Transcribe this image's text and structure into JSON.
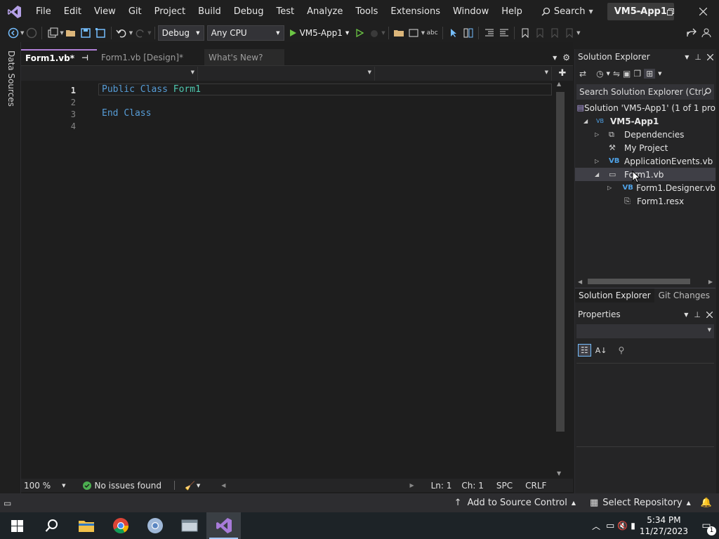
{
  "menu": [
    "File",
    "Edit",
    "View",
    "Git",
    "Project",
    "Build",
    "Debug",
    "Test",
    "Analyze",
    "Tools",
    "Extensions",
    "Window",
    "Help"
  ],
  "search_label": "Search",
  "project_badge": "VM5-App1",
  "toolbar": {
    "config": "Debug",
    "platform": "Any CPU",
    "run_label": "VM5-App1"
  },
  "left_strip": "Data Sources",
  "tabs": [
    {
      "label": "Form1.vb*",
      "active": true
    },
    {
      "label": "Form1.vb [Design]*",
      "active": false
    },
    {
      "label": "What's New?",
      "active": false
    }
  ],
  "code": {
    "line_numbers": [
      "1",
      "2",
      "3",
      "4"
    ],
    "line1": {
      "kw1": "Public",
      "kw2": "Class",
      "name": "Form1"
    },
    "line3": {
      "kw1": "End",
      "kw2": "Class"
    }
  },
  "editor_status": {
    "zoom": "100 %",
    "issues": "No issues found",
    "ln": "Ln: 1",
    "ch": "Ch: 1",
    "spc": "SPC",
    "crlf": "CRLF"
  },
  "solution_explorer": {
    "title": "Solution Explorer",
    "search_placeholder": "Search Solution Explorer (Ctrl",
    "items": [
      {
        "label": "Solution 'VM5-App1' (1 of 1 pro"
      },
      {
        "label": "VM5-App1"
      },
      {
        "label": "Dependencies"
      },
      {
        "label": "My Project"
      },
      {
        "label": "ApplicationEvents.vb"
      },
      {
        "label": "Form1.vb"
      },
      {
        "label": "Form1.Designer.vb"
      },
      {
        "label": "Form1.resx"
      }
    ],
    "bottom_tabs": [
      "Solution Explorer",
      "Git Changes"
    ]
  },
  "properties": {
    "title": "Properties"
  },
  "statusbar": {
    "source_control": "Add to Source Control",
    "repository": "Select Repository",
    "notification_count": "1"
  },
  "taskbar": {
    "time": "5:34 PM",
    "date": "11/27/2023",
    "notif_count": "1"
  },
  "colors": {
    "accent": "#b180d7",
    "keyword": "#569cd6",
    "type": "#4ec9b0",
    "selection": "#3f3f46",
    "vs_purple": "#68217a"
  }
}
